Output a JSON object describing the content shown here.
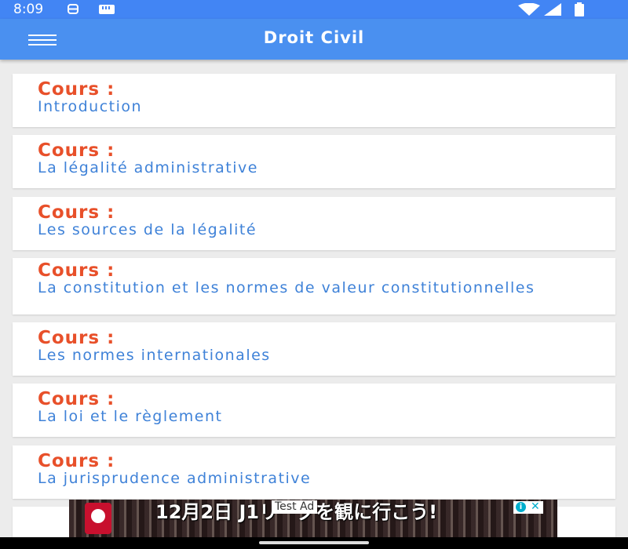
{
  "status_bar": {
    "time": "8:09"
  },
  "app_bar": {
    "title": "Droit Civil"
  },
  "list": [
    {
      "label": "Cours :",
      "title": "Introduction"
    },
    {
      "label": "Cours :",
      "title": "La légalité administrative"
    },
    {
      "label": "Cours :",
      "title": "Les sources de la légalité"
    },
    {
      "label": "Cours :",
      "title": "La constitution et les normes de valeur constitutionnelles"
    },
    {
      "label": "Cours :",
      "title": "Les normes internationales"
    },
    {
      "label": "Cours :",
      "title": "La loi et le règlement"
    },
    {
      "label": "Cours :",
      "title": "La jurisprudence administrative"
    }
  ],
  "ad": {
    "label": "Test Ad",
    "headline": "12月2日 J1リーグを観に行こう!",
    "info_icon": "info-icon",
    "close_icon": "close-icon"
  },
  "colors": {
    "app_bar": "#4a90f0",
    "status_bar": "#4285f4",
    "label": "#e8502a",
    "subtitle": "#3f82d8",
    "background": "#ececec"
  }
}
